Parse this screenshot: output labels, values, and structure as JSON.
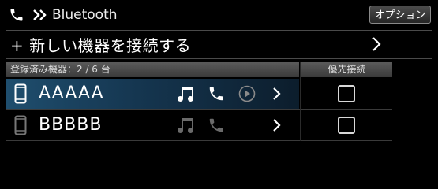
{
  "header": {
    "title": "Bluetooth",
    "option_label": "オプション"
  },
  "add_device": {
    "label": "+ 新しい機器を接続する"
  },
  "registered": {
    "label": "登録済み機器：2 / 6 台"
  },
  "priority_header": "優先接続",
  "devices": [
    {
      "name": "AAAAA",
      "selected": true,
      "audio_icon": "music-note-icon",
      "phone_icon": "phone-icon",
      "play_icon": "play-circle-icon",
      "priority_checked": false
    },
    {
      "name": "BBBBB",
      "selected": false,
      "audio_icon": "music-note-icon",
      "phone_icon": "phone-icon",
      "priority_checked": false
    }
  ],
  "colors": {
    "background": "#000000",
    "selected_row": "#1f4e6e",
    "header_bar": "#4a4a4a"
  }
}
